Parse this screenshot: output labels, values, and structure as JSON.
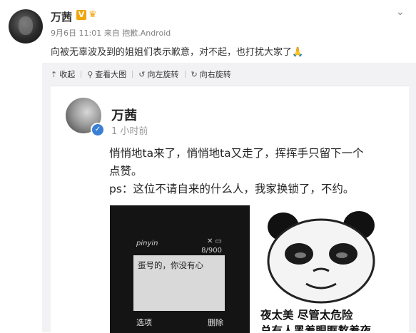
{
  "post": {
    "author": "万茜",
    "badge": "V",
    "meta_date": "9月6日 11:01",
    "meta_from": "来自",
    "meta_source": "抱歉.Android",
    "text": "向被无辜波及到的姐姐们表示歉意，对不起，也打扰大家了",
    "text_emoji": "🙏"
  },
  "toolbar": {
    "collapse": "收起",
    "view_large": "查看大图",
    "rotate_left": "向左旋转",
    "rotate_right": "向右旋转"
  },
  "screenshot": {
    "name": "万茜",
    "time": "1 小时前",
    "line1": "悄悄地ta来了，悄悄地ta又走了，挥挥手只留下一个",
    "line2": "点赞。",
    "line3": "ps：这位不请自来的什么人，我家换锁了，不约。",
    "phone_brand": "pinyin",
    "phone_counter": "8/900",
    "phone_message": "蛋号的，你没有心",
    "phone_left": "选项",
    "phone_right": "删除",
    "caption1": "夜太美 尽管太危险",
    "caption2": "总有人黑着眼眶熬着夜"
  }
}
